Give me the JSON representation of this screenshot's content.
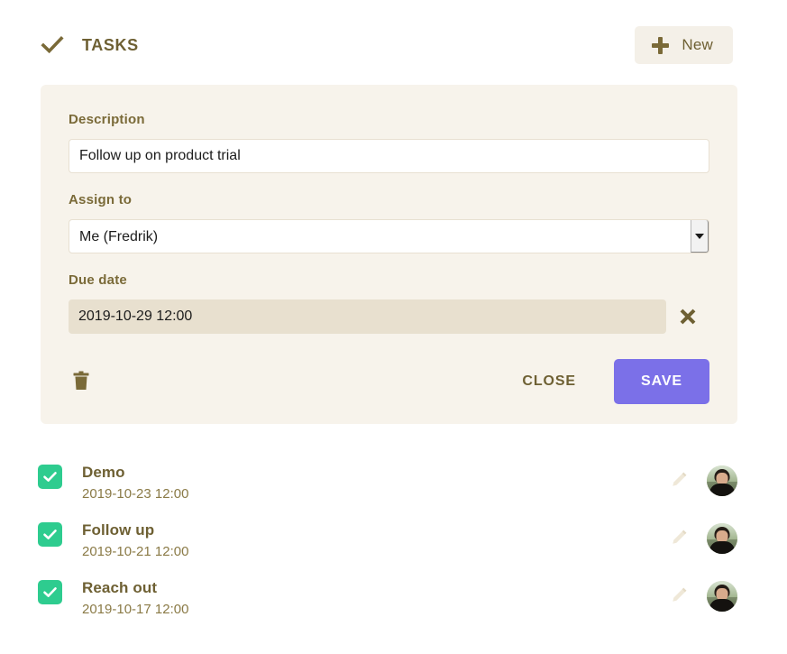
{
  "header": {
    "check_icon": "check-icon",
    "title": "TASKS",
    "new_button": {
      "icon": "plus-icon",
      "label": "New"
    }
  },
  "form": {
    "description": {
      "label": "Description",
      "value": "Follow up on product trial",
      "placeholder": ""
    },
    "assign_to": {
      "label": "Assign to",
      "value": "Me (Fredrik)",
      "options": [
        "Me (Fredrik)"
      ],
      "arrow_icon": "chevron-down-icon"
    },
    "due_date": {
      "label": "Due date",
      "value": "2019-10-29 12:00",
      "clear_icon": "close-x-icon"
    },
    "actions": {
      "delete_icon": "trash-icon",
      "close_label": "CLOSE",
      "save_label": "SAVE"
    }
  },
  "colors": {
    "panel_bg": "#F7F3EB",
    "page_bg": "#FFFFFF",
    "accent_olive": "#6E6033",
    "label_olive": "#7A6A38",
    "date_olive": "#8A7A46",
    "save_purple": "#7B70E8",
    "checkbox_green": "#2ECC8F",
    "due_date_bg": "#E8E0CF",
    "new_button_bg": "#F4F0E8",
    "input_border": "#E8E0D2"
  },
  "tasks": [
    {
      "checked": true,
      "title": "Demo",
      "date": "2019-10-23 12:00",
      "edit_icon": "pencil-icon",
      "avatar": "user-avatar"
    },
    {
      "checked": true,
      "title": "Follow up",
      "date": "2019-10-21 12:00",
      "edit_icon": "pencil-icon",
      "avatar": "user-avatar"
    },
    {
      "checked": true,
      "title": "Reach out",
      "date": "2019-10-17 12:00",
      "edit_icon": "pencil-icon",
      "avatar": "user-avatar"
    }
  ]
}
